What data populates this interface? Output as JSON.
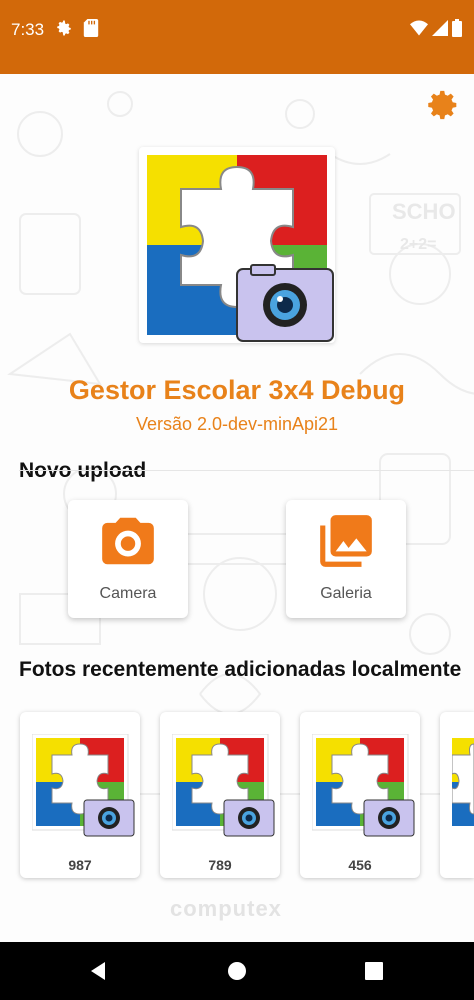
{
  "status_bar": {
    "time": "7:33",
    "icons": [
      "settings-gear",
      "sd-card",
      "wifi",
      "signal",
      "battery"
    ],
    "color": "#d2690a"
  },
  "header": {
    "settings_icon": "gear-icon",
    "settings_color": "#e8821a"
  },
  "app": {
    "title": "Gestor Escolar 3x4 Debug",
    "version": "Versão 2.0-dev-minApi21",
    "accent": "#e8821a"
  },
  "upload": {
    "section_title": "Novo upload",
    "actions": [
      {
        "label": "Camera",
        "icon": "camera-icon"
      },
      {
        "label": "Galeria",
        "icon": "gallery-icon"
      }
    ]
  },
  "recent": {
    "section_title": "Fotos recentemente adicionadas localmente",
    "photos": [
      {
        "caption": "987"
      },
      {
        "caption": "789"
      },
      {
        "caption": "456"
      }
    ]
  },
  "watermark": "computex",
  "nav": {
    "icons": [
      "back-icon",
      "home-icon",
      "recents-icon"
    ]
  }
}
